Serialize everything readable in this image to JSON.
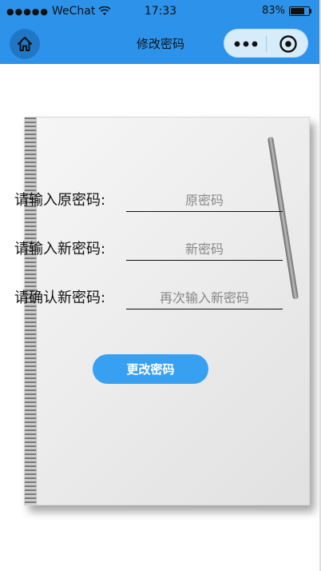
{
  "status_bar": {
    "signal": "●●●●●",
    "carrier": "WeChat",
    "time": "17:33",
    "battery_text": "83%",
    "battery_level": 0.83
  },
  "nav_bar": {
    "title": "修改密码",
    "home_icon": "home-icon",
    "more_icon": "more-dots-icon",
    "target_icon": "target-icon"
  },
  "form": {
    "old_password": {
      "label": "请输入原密码:",
      "placeholder": "原密码"
    },
    "new_password": {
      "label": "请输入新密码:",
      "placeholder": "新密码"
    },
    "confirm_password": {
      "label": "请确认新密码:",
      "placeholder": "再次输入新密码"
    }
  },
  "submit": {
    "label": "更改密码"
  },
  "colors": {
    "brand_blue": "#2d93ea",
    "button_blue": "#38a0f1"
  }
}
